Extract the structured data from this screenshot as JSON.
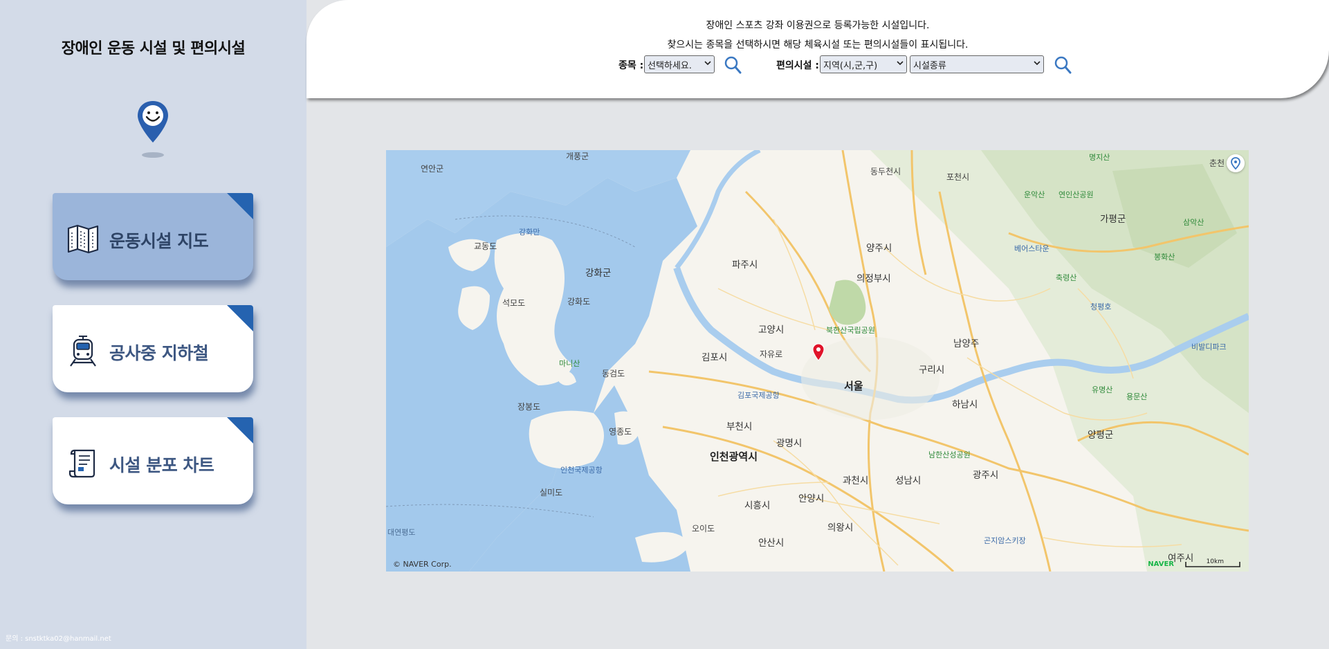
{
  "sidebar": {
    "title": "장애인 운동 시설 및 편의시설",
    "nav": [
      {
        "label": "운동시설 지도",
        "icon": "map-icon"
      },
      {
        "label": "공사중 지하철",
        "icon": "subway-train-icon"
      },
      {
        "label": "시설 분포 차트",
        "icon": "scroll-document-icon"
      }
    ],
    "contact": "문의 : snstktka02@hanmail.net",
    "accent_color": "#2563b0"
  },
  "header": {
    "line1": "장애인 스포츠 강좌 이용권으로 등록가능한 시설입니다.",
    "line2": "찾으시는 종목을 선택하시면 해당 체육시설 또는 편의시설들이 표시됩니다.",
    "sport_label": "종목 :",
    "sport_select": "선택하세요.",
    "facility_label": "편의시설 :",
    "region_select": "지역(시,군,구)",
    "type_select": "시설종류"
  },
  "map": {
    "labels": {
      "yeonan": "연안군",
      "gaepung": "개풍군",
      "dongducheon": "동두천시",
      "pocheon": "포천시",
      "chuncheon": "춘천",
      "gyodongdo": "교동도",
      "ganghwamun": "강화만",
      "ganghwagun": "강화군",
      "paju": "파주시",
      "yangju": "양주시",
      "gapyeong": "가평군",
      "seongmodo": "석모도",
      "ganghwado": "강화도",
      "uijeongbu": "의정부시",
      "goyang": "고양시",
      "namyangju": "남양주",
      "gimpo": "김포시",
      "guri": "구리시",
      "seoul": "서울",
      "manisan": "마니산",
      "donggeomdo": "동검도",
      "hanam": "하남시",
      "jangbongdo": "장봉도",
      "yeongjongdo": "영종도",
      "bucheon": "부천시",
      "gwangmyeong": "광명시",
      "yangpyeong": "양평군",
      "incheon": "인천광역시",
      "gwacheon": "과천시",
      "seongnam": "성남시",
      "gwangju": "광주시",
      "silmido": "실미도",
      "siheung": "시흥시",
      "anyang": "안양시",
      "uiwang": "의왕시",
      "ansan": "안산시",
      "yeoju": "여주시",
      "daebudo": "대연평도",
      "ohido": "오이도",
      "bukhansan": "북한산국립공원",
      "namhansanseong": "남한산성공원",
      "gimpo_airport": "김포국제공항",
      "incheon_airport": "인천국제공항",
      "unaksan": "운악산",
      "yeonin": "연인산공원",
      "chukryeong": "축령산",
      "samaksan": "삼악산",
      "bonghwasan": "봉화산",
      "yumyeong": "유명산",
      "yongmun": "용문산",
      "myeongji": "명지산",
      "cheongpyeong": "청평호",
      "bealpada": "베어스타운",
      "gonjiam": "곤지암스키장",
      "bidigitaka": "비발디파크",
      "jayuro": "자유로"
    },
    "copyright": "© NAVER Corp.",
    "naver_logo": "NAVER",
    "scale": "10km"
  }
}
